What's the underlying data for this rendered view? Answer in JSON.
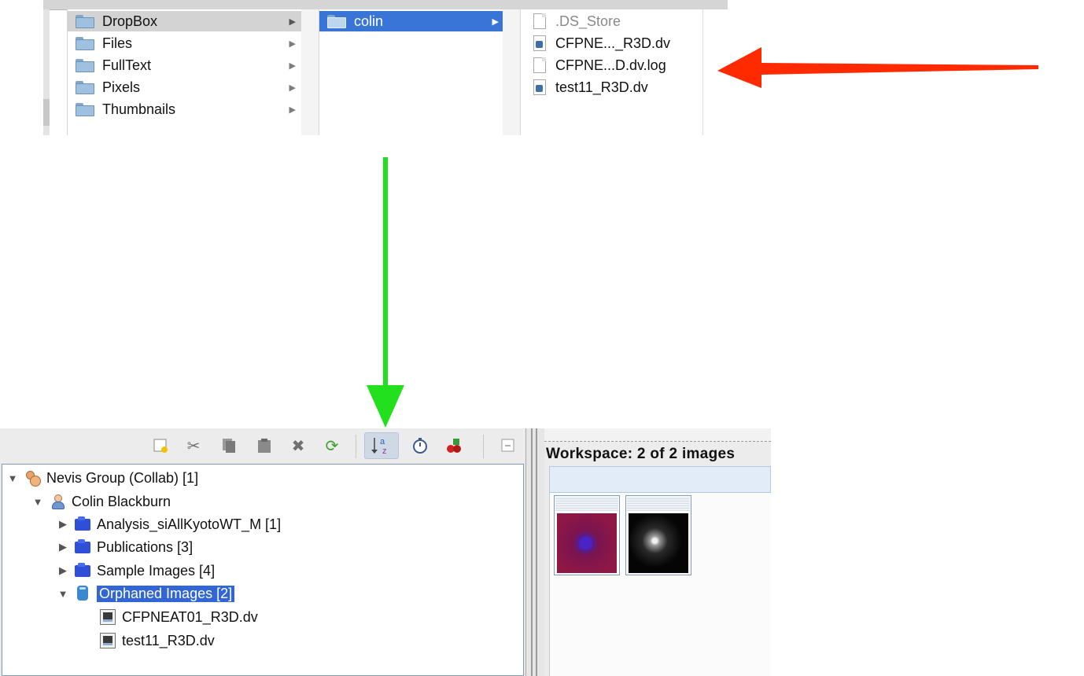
{
  "colors": {
    "red_arrow": "#ff2a00",
    "green_arrow": "#22e01e",
    "finder_selection": "#3875d7",
    "tree_selection": "#3266d6"
  },
  "finder": {
    "column1": [
      {
        "label": "DropBox",
        "icon": "folder-icon",
        "state": "selected-inactive"
      },
      {
        "label": "Files",
        "icon": "folder-icon"
      },
      {
        "label": "FullText",
        "icon": "folder-icon"
      },
      {
        "label": "Pixels",
        "icon": "folder-icon"
      },
      {
        "label": "Thumbnails",
        "icon": "folder-icon"
      }
    ],
    "column2": [
      {
        "label": "colin",
        "icon": "folder-icon",
        "state": "selected"
      }
    ],
    "column3": [
      {
        "label": ".DS_Store",
        "icon": "file-icon",
        "state": "dimmed"
      },
      {
        "label": "CFPNE..._R3D.dv",
        "icon": "image-file-icon"
      },
      {
        "label": "CFPNE...D.dv.log",
        "icon": "file-icon"
      },
      {
        "label": "test11_R3D.dv",
        "icon": "image-file-icon"
      }
    ]
  },
  "toolbar": {
    "buttons": [
      "new-container-icon",
      "cut-icon",
      "copy-icon",
      "paste-icon",
      "delete-icon",
      "refresh-icon",
      "sort-az-icon",
      "timer-icon",
      "tag-icon",
      "collapse-icon"
    ]
  },
  "tree": {
    "group": "Nevis Group (Collab) [1]",
    "user": "Colin Blackburn",
    "projects": [
      "Analysis_siAllKyotoWT_M [1]",
      "Publications [3]",
      "Sample Images [4]"
    ],
    "orphaned": "Orphaned Images [2]",
    "images": [
      "CFPNEAT01_R3D.dv",
      "test11_R3D.dv"
    ]
  },
  "workspace": {
    "title": "Workspace: 2 of 2 images"
  }
}
